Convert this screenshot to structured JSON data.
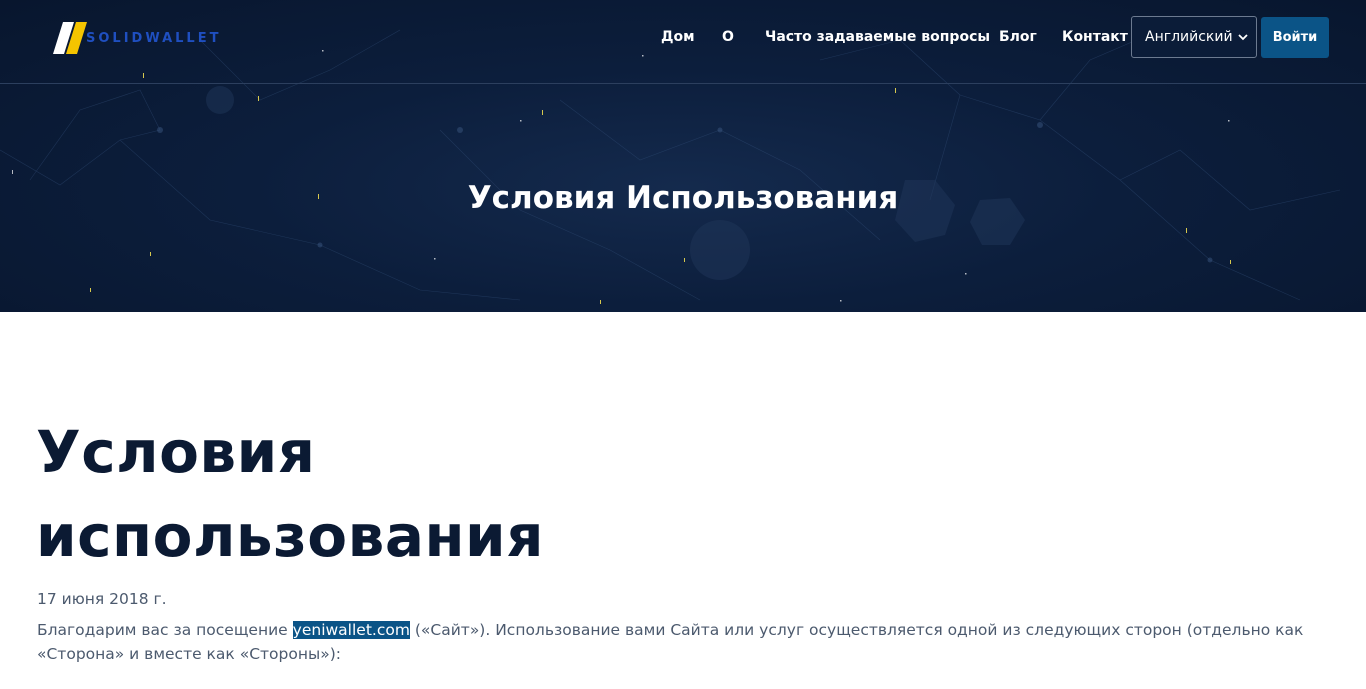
{
  "brand": {
    "name": "SOLIDWALLET",
    "colors": {
      "mark_yellow": "#f5c400",
      "mark_white": "#ffffff",
      "text": "#1f4fc0"
    }
  },
  "nav": {
    "items": [
      {
        "label": "Дом"
      },
      {
        "label": "О"
      },
      {
        "label": "Часто задаваемые вопросы"
      },
      {
        "label": "Блог"
      },
      {
        "label": "Контакт"
      }
    ],
    "language": {
      "selected": "Английский",
      "icon": "chevron-down-icon"
    },
    "login_label": "Войти"
  },
  "hero": {
    "title": "Условия Использования"
  },
  "content": {
    "title": "Условия использования",
    "date": "17 июня 2018 г.",
    "intro": {
      "before": "Благодарим вас за посещение ",
      "link": "yeniwallet.com",
      "after": " («Сайт»). Использование вами Сайта или услуг осуществляется одной из следующих сторон (отдельно как «Сторона» и вместе как «Стороны»):"
    }
  },
  "colors": {
    "hero_bg": "#0c1e3c",
    "accent_button": "#0b5487",
    "heading": "#0b1a33",
    "body_text": "#4c5a6e",
    "selection_highlight": "#0b5487"
  }
}
